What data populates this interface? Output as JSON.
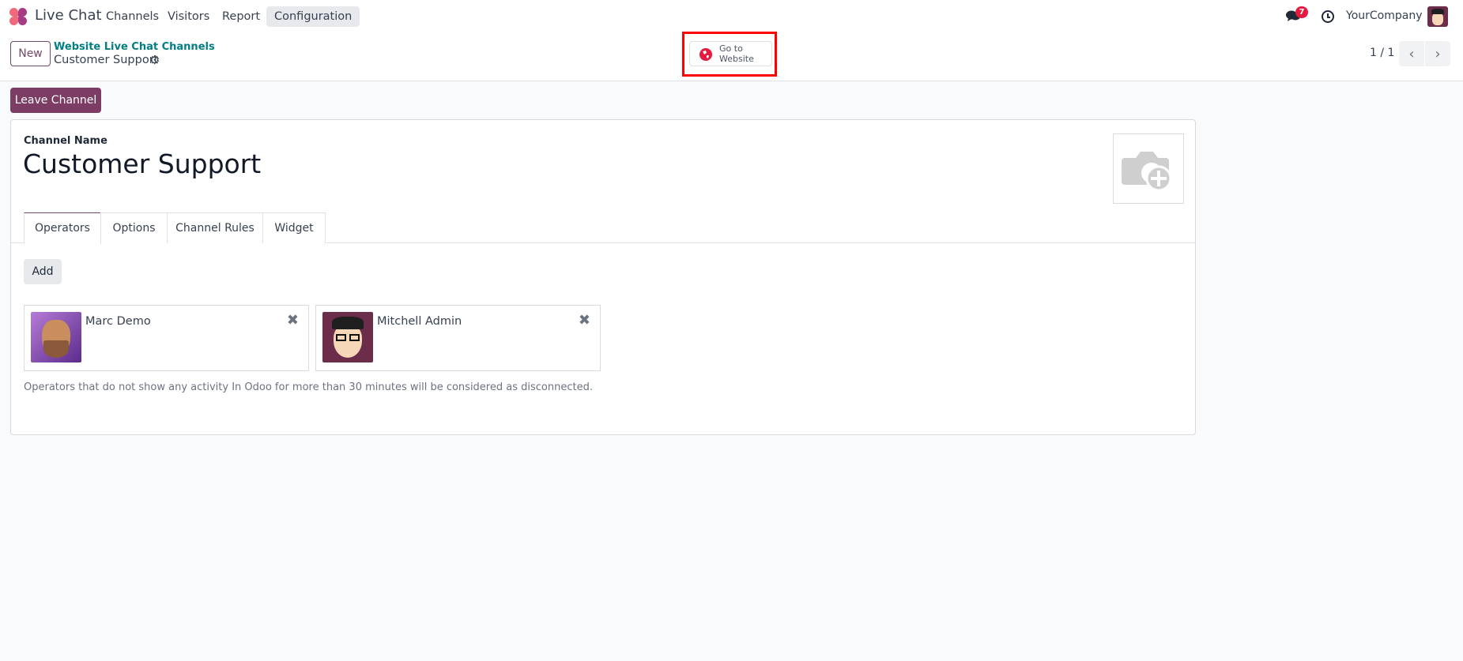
{
  "topbar": {
    "app_name": "Live Chat",
    "menu": [
      "Channels",
      "Visitors",
      "Report",
      "Configuration"
    ],
    "messages_badge": "7",
    "company": "YourCompany"
  },
  "control_panel": {
    "new_label": "New",
    "breadcrumb_parent": "Website Live Chat Channels",
    "breadcrumb_current": "Customer Support",
    "go_to_website": [
      "Go to",
      "Website"
    ],
    "pager": "1 / 1"
  },
  "actions": {
    "leave_channel": "Leave Channel"
  },
  "form": {
    "channel_name_label": "Channel Name",
    "channel_name": "Customer Support",
    "tabs": [
      "Operators",
      "Options",
      "Channel Rules",
      "Widget"
    ],
    "add_label": "Add",
    "operators": [
      {
        "name": "Marc Demo"
      },
      {
        "name": "Mitchell Admin"
      }
    ],
    "note": "Operators that do not show any activity In Odoo for more than 30 minutes will be considered as disconnected."
  },
  "colors": {
    "brand": "#714B67",
    "leave_button": "#7c3c63",
    "link": "#017e84",
    "badge": "#e6193f",
    "highlight": "#ff0000"
  }
}
